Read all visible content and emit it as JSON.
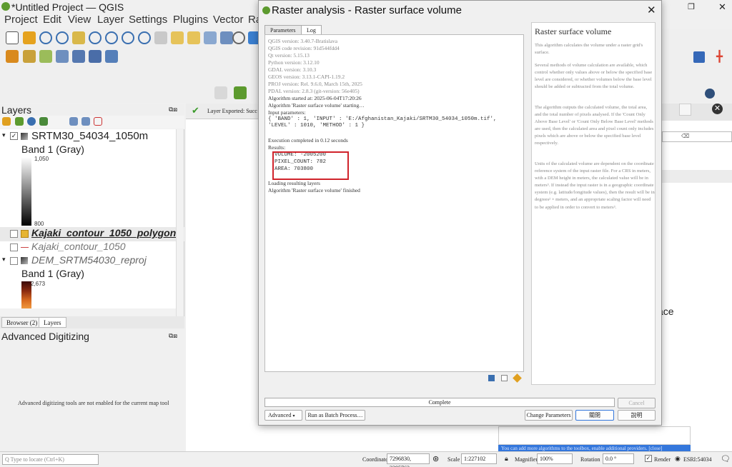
{
  "app": {
    "title": "*Untitled Project — QGIS",
    "menus": [
      "Project",
      "Edit",
      "View",
      "Layer",
      "Settings",
      "Plugins",
      "Vector",
      "Ra"
    ]
  },
  "layers_panel": {
    "title": "Layers",
    "layers": [
      {
        "name": "SRTM30_54034_1050m",
        "checked": true,
        "band": "Band 1 (Gray)",
        "max": "1,050",
        "min": "800"
      },
      {
        "name": "Kajaki_contour_1050_polygon",
        "checked": false
      },
      {
        "name": "Kajaki_contour_1050",
        "checked": false
      },
      {
        "name": "DEM_SRTM54030_reproj",
        "checked": false,
        "band": "Band 1 (Gray)",
        "max": "2,673"
      }
    ],
    "tabs": [
      "Browser (2)",
      "Layers"
    ]
  },
  "adv_digitizing": {
    "title": "Advanced Digitizing",
    "message": "Advanced digitizing tools are not enabled for the current map tool"
  },
  "map": {
    "exported_msg": "Layer Exported: Succ",
    "partial_text": "ace",
    "toolbox_notice": "You can add more algorithms to the toolbox, enable additional providers. [close]"
  },
  "statusbar": {
    "locate_placeholder": "Q  Type to locate (Ctrl+K)",
    "coordinate_label": "Coordinate",
    "coordinate": "7296830, 3395763",
    "scale_label": "Scale",
    "scale": "1:227102",
    "magnifier_label": "Magnifier",
    "magnifier": "100%",
    "rotation_label": "Rotation",
    "rotation": "0.0 °",
    "render_label": "Render",
    "crs": "ESRI:54034"
  },
  "dialog": {
    "title": "Raster analysis - Raster surface volume",
    "tabs": [
      "Parameters",
      "Log"
    ],
    "log_lines": [
      "QGIS version: 3.40.7-Bratislava",
      "QGIS code revision: 91d544fdd4",
      "Qt version: 5.15.13",
      "Python version: 3.12.10",
      "GDAL version: 3.10.3",
      "GEOS version: 3.13.1-CAPI-1.19.2",
      "PROJ version: Rel. 9.6.0, March 15th, 2025",
      "PDAL version: 2.8.3 (git-version: 56e405)",
      "Algorithm started at: 2025-06-04T17:20:26",
      "Algorithm 'Raster surface volume' starting…",
      "Input parameters:",
      "{ 'BAND' : 1, 'INPUT' : 'E:/Afghanistan_Kajaki/SRTM30_54034_1050m.tif',",
      "'LEVEL' : 1010, 'METHOD' : 1 }",
      "Execution completed in 0.12 seconds",
      "Results:",
      "VOLUME: -2005200",
      "PIXEL_COUNT: 782",
      "AREA: 703800",
      "Loading resulting layers",
      "Algorithm 'Raster surface volume' finished"
    ],
    "help_title": "Raster surface volume",
    "help_paragraphs": [
      "This algorithm calculates the volume under a raster grid's surface.",
      "Several methods of volume calculation are available, which control whether only values above or below the specified base level are considered, or whether volumes below the base level should be added or subtracted from the total volume.",
      "The algorithm outputs the calculated volume, the total area, and the total number of pixels analysed. If the 'Count Only Above Base Level' or 'Count Only Below Base Level' methods are used, then the calculated area and pixel count only includes pixels which are above or below the specified base level respectively.",
      "Units of the calculated volume are dependent on the coordinate reference system of the input raster file. For a CRS in meters, with a DEM height in meters, the calculated value will be in meters³. If instead the input raster is in a geographic coordinate system (e.g. latitude/longitude values), then the result will be in degrees² × meters, and an appropriate scaling factor will need to be applied in order to convert to meters³."
    ],
    "progress_text": "Complete",
    "buttons": {
      "cancel": "Cancel",
      "advanced": "Advanced",
      "batch": "Run as Batch Process…",
      "change_params": "Change Parameters",
      "close": "關閉",
      "help": "說明"
    }
  }
}
